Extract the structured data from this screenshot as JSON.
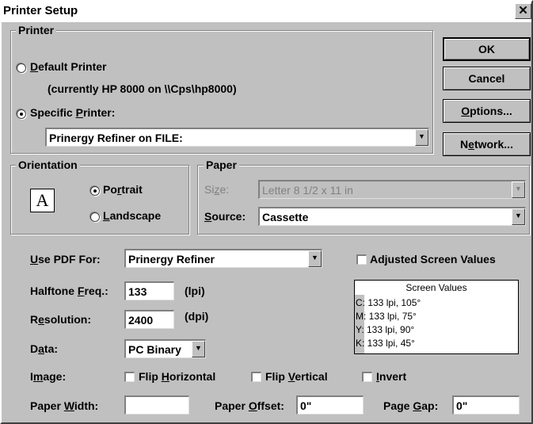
{
  "window": {
    "title": "Printer Setup",
    "close_glyph": "✕"
  },
  "buttons": {
    "ok": "OK",
    "cancel": "Cancel",
    "options_u": "O",
    "options_rest": "ptions...",
    "network_a": "N",
    "network_u": "e",
    "network_rest": "twork..."
  },
  "printer": {
    "legend": "Printer",
    "default_u": "D",
    "default_rest": "efault Printer",
    "current": "(currently HP 8000 on \\\\Cps\\hp8000)",
    "specific_a": "Specific ",
    "specific_u": "P",
    "specific_rest": "rinter:",
    "selected": "Prinergy Refiner on FILE:",
    "default_checked": false,
    "specific_checked": true
  },
  "orientation": {
    "legend": "Orientation",
    "glyph": "A",
    "portrait_a": "Po",
    "portrait_u": "r",
    "portrait_rest": "trait",
    "landscape_u": "L",
    "landscape_rest": "andscape",
    "selected": "Portrait"
  },
  "paper": {
    "legend": "Paper",
    "size_a": "Si",
    "size_u": "z",
    "size_rest": "e:",
    "size_value": "Letter 8 1/2 x 11 in",
    "source_u": "S",
    "source_rest": "ource:",
    "source_value": "Cassette"
  },
  "use_pdf": {
    "label_u": "U",
    "label_rest": "se PDF For:",
    "value": "Prinergy Refiner"
  },
  "adjusted": {
    "label": "Adjusted Screen Values",
    "checked": false
  },
  "halftone": {
    "label_a": "Halftone ",
    "label_u": "F",
    "label_rest": "req.:",
    "value": "133",
    "unit": "(lpi)"
  },
  "resolution": {
    "label_a": "R",
    "label_u": "e",
    "label_rest": "solution:",
    "value": "2400",
    "unit": "(dpi)"
  },
  "data_field": {
    "label_a": "D",
    "label_u": "a",
    "label_rest": "ta:",
    "value": "PC Binary"
  },
  "screen_values": {
    "title": "Screen Values",
    "rows": [
      "C: 133 lpi, 105°",
      "M: 133 lpi, 75°",
      "Y: 133 lpi, 90°",
      "K: 133 lpi, 45°"
    ]
  },
  "image": {
    "label_a": "I",
    "label_u": "m",
    "label_rest": "age:",
    "flip_h_a": "Flip ",
    "flip_h_u": "H",
    "flip_h_rest": "orizontal",
    "flip_v_a": "Flip ",
    "flip_v_u": "V",
    "flip_v_rest": "ertical",
    "invert_u": "I",
    "invert_rest": "nvert"
  },
  "paper_width": {
    "label_a": "Paper ",
    "label_u": "W",
    "label_rest": "idth:",
    "value": ""
  },
  "paper_offset": {
    "label_a": "Paper ",
    "label_u": "O",
    "label_rest": "ffset:",
    "value": "0\""
  },
  "page_gap": {
    "label_a": "Page ",
    "label_u": "G",
    "label_rest": "ap:",
    "value": "0\""
  },
  "icons": {
    "dropdown": "▼",
    "close": "close-icon"
  }
}
